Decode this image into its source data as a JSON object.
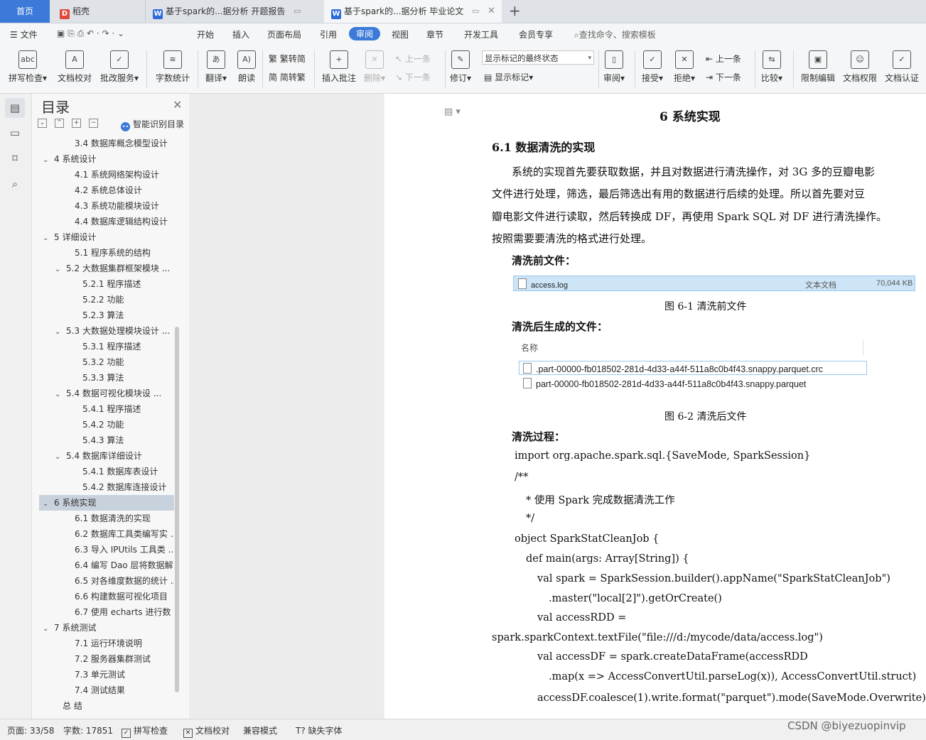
{
  "tabs": {
    "home": "首页",
    "docer": "稻壳",
    "doc1": "基于spark的...据分析 开题报告",
    "doc2": "基于spark的...据分析 毕业论文",
    "new_tab": "+"
  },
  "menu": {
    "file": "文件",
    "items": [
      "开始",
      "插入",
      "页面布局",
      "引用",
      "审阅",
      "视图",
      "章节",
      "开发工具",
      "会员专享"
    ],
    "search": "查找命令、搜索模板"
  },
  "ribbon": {
    "spell_check": "拼写检查",
    "doc_proof": "文档校对",
    "annotate_service": "批改服务",
    "word_count": "字数统计",
    "translate": "翻译",
    "read_aloud": "朗读",
    "to_traditional": "繁转简",
    "to_simplified": "简转繁",
    "insert_comment": "插入批注",
    "delete": "删除",
    "prev": "上一条",
    "next": "下一条",
    "track_changes": "修订",
    "markup_select": "显示标记的最终状态",
    "show_markup": "显示标记",
    "review": "审阅",
    "accept": "接受",
    "reject": "拒绝",
    "prev2": "上一条",
    "next2": "下一条",
    "compare": "比较",
    "restrict_edit": "限制编辑",
    "doc_permission": "文档权限",
    "doc_certify": "文档认证"
  },
  "toc": {
    "title": "目录",
    "smart": "智能识别目录",
    "items": [
      {
        "text": "3.4  数据库概念模型设计",
        "level": 2,
        "arrow": ""
      },
      {
        "text": "4  系统设计",
        "level": 1,
        "arrow": "v"
      },
      {
        "text": "4.1  系统网络架构设计",
        "level": 2,
        "arrow": ""
      },
      {
        "text": "4.2  系统总体设计",
        "level": 2,
        "arrow": ""
      },
      {
        "text": "4.3  系统功能模块设计",
        "level": 2,
        "arrow": ""
      },
      {
        "text": "4.4  数据库逻辑结构设计",
        "level": 2,
        "arrow": ""
      },
      {
        "text": "5  详细设计",
        "level": 1,
        "arrow": "v"
      },
      {
        "text": "5.1  程序系统的结构",
        "level": 2,
        "arrow": ""
      },
      {
        "text": "5.2  大数据集群框架模块 ...",
        "level": 2,
        "arrow": "v"
      },
      {
        "text": "5.2.1  程序描述",
        "level": 3,
        "arrow": ""
      },
      {
        "text": "5.2.2  功能",
        "level": 3,
        "arrow": ""
      },
      {
        "text": "5.2.3  算法",
        "level": 3,
        "arrow": ""
      },
      {
        "text": "5.3  大数据处理模块设计 ...",
        "level": 2,
        "arrow": "v"
      },
      {
        "text": "5.3.1  程序描述",
        "level": 3,
        "arrow": ""
      },
      {
        "text": "5.3.2  功能",
        "level": 3,
        "arrow": ""
      },
      {
        "text": "5.3.3  算法",
        "level": 3,
        "arrow": ""
      },
      {
        "text": "5.4    数据可视化模块设 ...",
        "level": 2,
        "arrow": "v"
      },
      {
        "text": "5.4.1  程序描述",
        "level": 3,
        "arrow": ""
      },
      {
        "text": "5.4.2  功能",
        "level": 3,
        "arrow": ""
      },
      {
        "text": "5.4.3  算法",
        "level": 3,
        "arrow": ""
      },
      {
        "text": "5.4    数据库详细设计",
        "level": 2,
        "arrow": "v"
      },
      {
        "text": "5.4.1  数据库表设计",
        "level": 3,
        "arrow": ""
      },
      {
        "text": "5.4.2  数据库连接设计",
        "level": 3,
        "arrow": ""
      },
      {
        "text": "6  系统实现",
        "level": 1,
        "arrow": "v"
      },
      {
        "text": "6.1  数据清洗的实现",
        "level": 2,
        "arrow": ""
      },
      {
        "text": "6.2  数据库工具类编写实 ...",
        "level": 2,
        "arrow": ""
      },
      {
        "text": "6.3 导入 IPUtils 工具类 ...",
        "level": 2,
        "arrow": ""
      },
      {
        "text": "6.4 编写 Dao 层将数据解 ...",
        "level": 2,
        "arrow": ""
      },
      {
        "text": "6.5  对各维度数据的统计 ...",
        "level": 2,
        "arrow": ""
      },
      {
        "text": "6.6  构建数据可视化项目",
        "level": 2,
        "arrow": ""
      },
      {
        "text": "6.7  使用 echarts 进行数 ...",
        "level": 2,
        "arrow": ""
      },
      {
        "text": "7  系统测试",
        "level": 1,
        "arrow": "v"
      },
      {
        "text": "7.1  运行环境说明",
        "level": 2,
        "arrow": ""
      },
      {
        "text": "7.2  服务器集群测试",
        "level": 2,
        "arrow": ""
      },
      {
        "text": "7.3  单元测试",
        "level": 2,
        "arrow": ""
      },
      {
        "text": "7.4  测试结果",
        "level": 2,
        "arrow": ""
      },
      {
        "text": "总    结",
        "level": 1,
        "arrow": ""
      }
    ],
    "selected_index": 23
  },
  "doc": {
    "chapter": "6  系统实现",
    "section": "6.1  数据清洗的实现",
    "para1": "系统的实现首先要获取数据，并且对数据进行清洗操作，对 3G 多的豆瓣电影",
    "para2": "文件进行处理，筛选，最后筛选出有用的数据进行后续的处理。所以首先要对豆",
    "para3": "瓣电影文件进行读取，然后转换成 DF，再使用 Spark SQL 对 DF 进行清洗操作。",
    "para4": "按照需要要清洗的格式进行处理。",
    "before_label": "清洗前文件：",
    "file1_name": "access.log",
    "file1_type": "文本文档",
    "file1_size": "70,044 KB",
    "fig1": "图 6-1  清洗前文件",
    "after_label": "清洗后生成的文件：",
    "col_name": "名称",
    "file2": ".part-00000-fb018502-281d-4d33-a44f-511a8c0b4f43.snappy.parquet.crc",
    "file3": "part-00000-fb018502-281d-4d33-a44f-511a8c0b4f43.snappy.parquet",
    "fig2": "图 6-2  清洗后文件",
    "process_label": "清洗过程：",
    "code": [
      "import org.apache.spark.sql.{SaveMode,    SparkSession}",
      "/**",
      "* 使用 Spark 完成数据清洗工作",
      "*/",
      "object SparkStatCleanJob {",
      "def main(args: Array[String]) {",
      "val spark = SparkSession.builder().appName(\"SparkStatCleanJob\")",
      ".master(\"local[2]\").getOrCreate()",
      "val accessRDD =",
      "spark.sparkContext.textFile(\"file:///d:/mycode/data/access.log\")",
      "val accessDF = spark.createDataFrame(accessRDD",
      ".map(x => AccessConvertUtil.parseLog(x)),    AccessConvertUtil.struct)",
      "accessDF.coalesce(1).write.format(\"parquet\").mode(SaveMode.Overwrite)"
    ]
  },
  "status": {
    "page": "页面: 33/58",
    "words": "字数: 17851",
    "spell": "拼写检查",
    "proof": "文档校对",
    "compat": "兼容模式",
    "missing_font": "缺失字体"
  },
  "watermark": "CSDN @biyezuopinvip"
}
